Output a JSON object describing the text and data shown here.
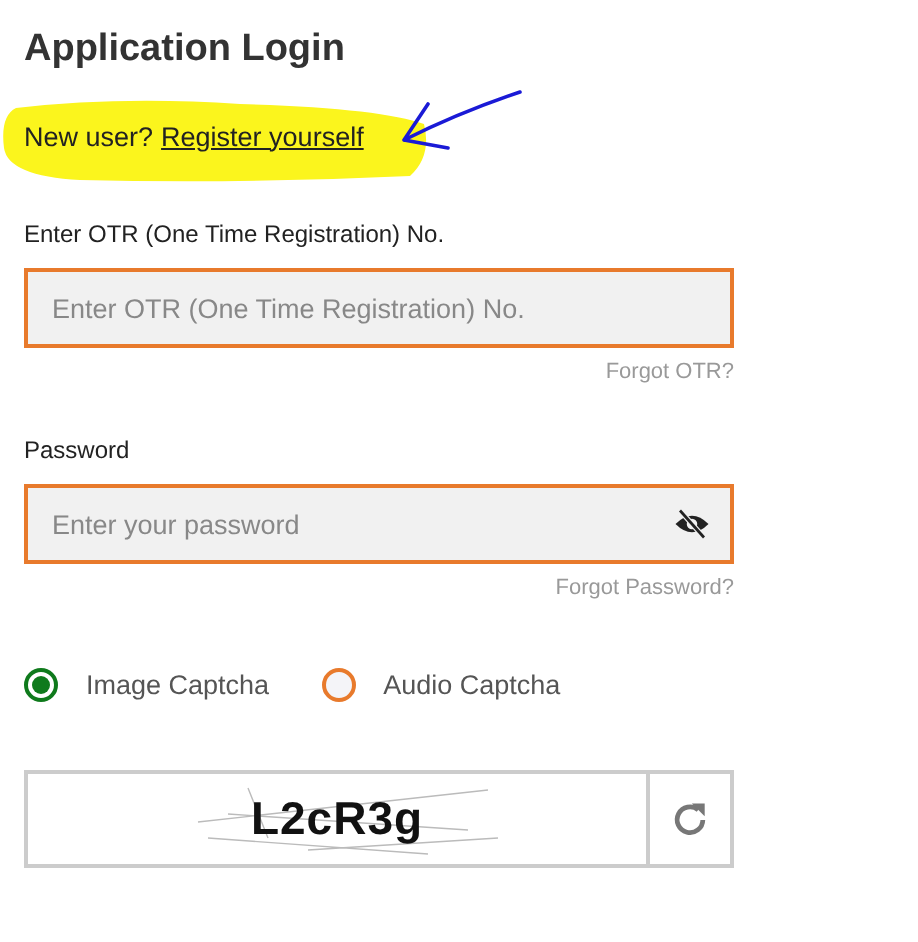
{
  "title": "Application Login",
  "register": {
    "prompt": "New user?",
    "link": "Register yourself"
  },
  "fields": [
    {
      "kind": "text",
      "label": "Enter OTR (One Time Registration) No.",
      "placeholder": "Enter OTR (One Time Registration) No.",
      "forgot": "Forgot OTR?"
    },
    {
      "kind": "password",
      "label": "Password",
      "placeholder": "Enter your password",
      "forgot": "Forgot Password?"
    }
  ],
  "captcha_options": [
    {
      "label": "Image Captcha",
      "selected": true
    },
    {
      "label": "Audio Captcha",
      "selected": false
    }
  ],
  "captcha": {
    "text": "L2cR3g"
  }
}
